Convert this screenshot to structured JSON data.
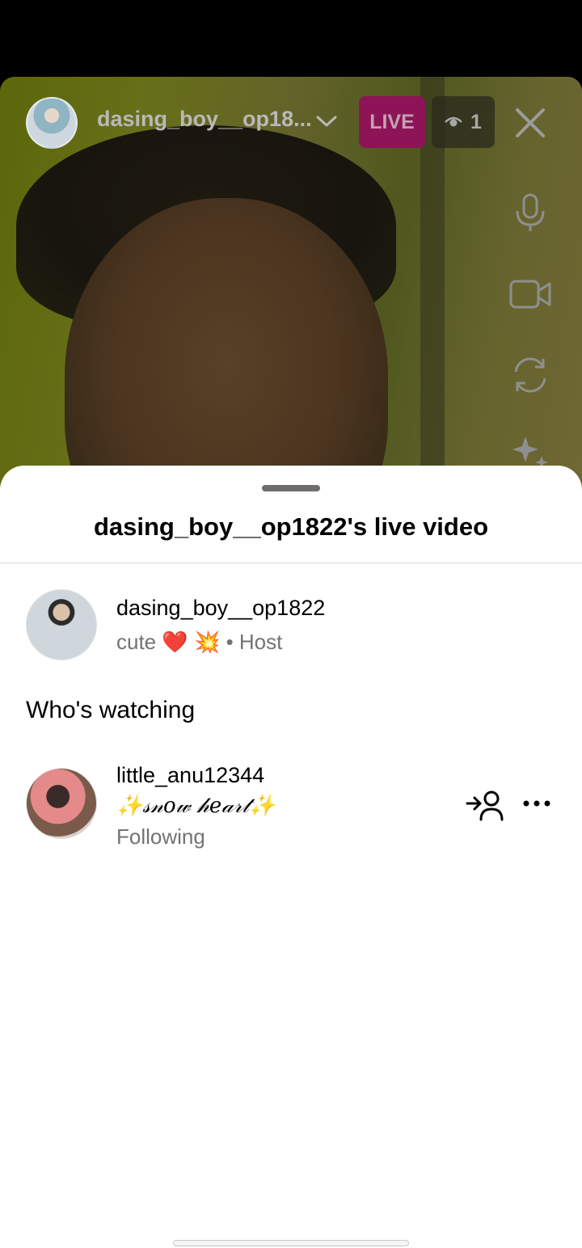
{
  "live": {
    "host_username_truncated": "dasing_boy__op18...",
    "live_label": "LIVE",
    "viewer_count": "1",
    "colors": {
      "live_badge": "#8c1457"
    },
    "icons": [
      "chevron-down-icon",
      "eye-icon",
      "close-icon",
      "microphone-icon",
      "video-camera-icon",
      "flip-camera-icon",
      "sparkles-icon"
    ]
  },
  "sheet": {
    "title": "dasing_boy__op1822's live video",
    "host": {
      "username": "dasing_boy__op1822",
      "bio": "cute ❤️ 💥",
      "role": " • Host"
    },
    "section_title": "Who's watching",
    "viewers": [
      {
        "username": "little_anu12344",
        "bio": "✨𝓈𝓃𝑜𝓌 𝒽𝑒𝒶𝓇𝓉✨",
        "status": "Following",
        "icons": [
          "add-user-icon",
          "more-options-icon"
        ]
      }
    ]
  }
}
